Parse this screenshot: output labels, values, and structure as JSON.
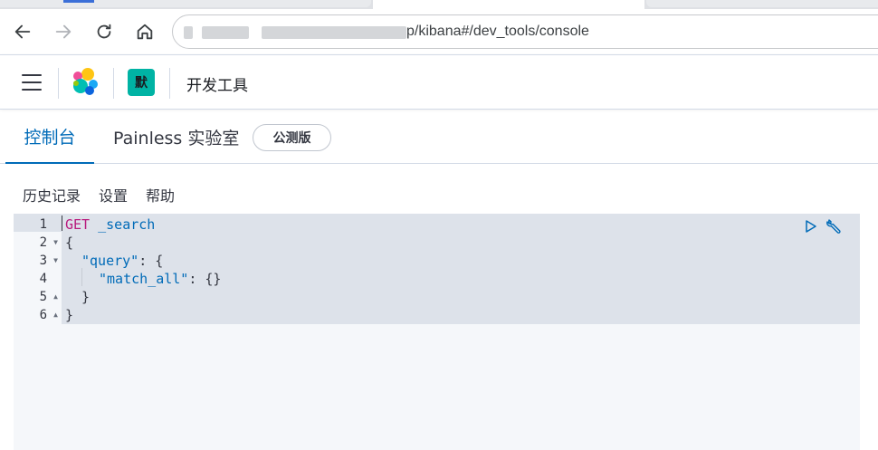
{
  "browser": {
    "url_visible": "p/kibana#/dev_tools/console",
    "icons": [
      "back-icon",
      "forward-icon",
      "reload-icon",
      "home-icon"
    ]
  },
  "header": {
    "space_initial": "默",
    "page_title": "开发工具"
  },
  "tabs": [
    {
      "label": "控制台",
      "active": true
    },
    {
      "label": "Painless 实验室",
      "active": false
    }
  ],
  "beta_badge": "公测版",
  "console_menu": {
    "history": "历史记录",
    "settings": "设置",
    "help": "帮助"
  },
  "editor": {
    "line_numbers": [
      "1",
      "2",
      "3",
      "4",
      "5",
      "6"
    ],
    "lines": {
      "l1_method": "GET",
      "l1_path": " _search",
      "l2": "{",
      "l3_key": "\"query\"",
      "l3_rest": ": {",
      "l4_key": "\"match_all\"",
      "l4_rest": ": {}",
      "l5": "}",
      "l6": "}"
    }
  },
  "colors": {
    "accent": "#006bb8",
    "method": "#b81a7d",
    "space_badge": "#00b3a4"
  }
}
